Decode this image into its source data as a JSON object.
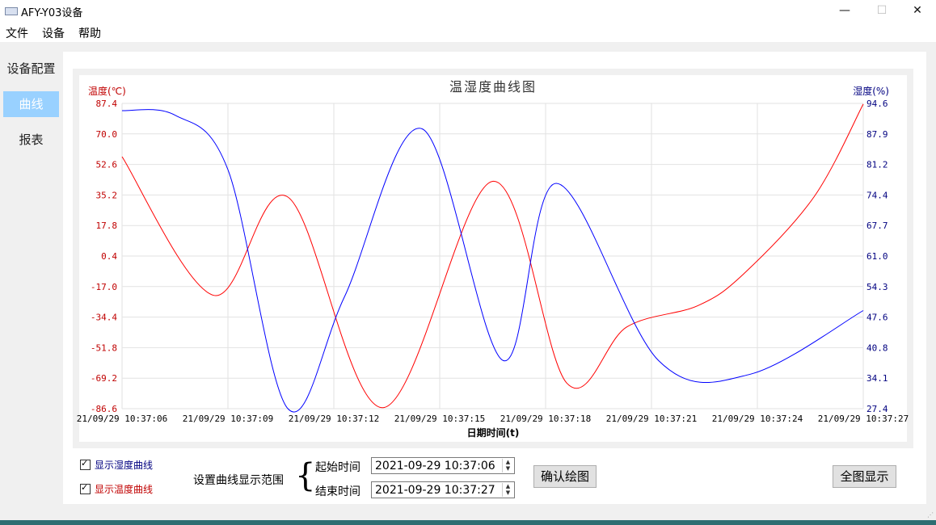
{
  "window": {
    "title": "AFY-Y03设备",
    "controls": {
      "minimize": "—",
      "maximize": "☐",
      "close": "✕"
    }
  },
  "menu": {
    "items": [
      "文件",
      "设备",
      "帮助"
    ]
  },
  "sidebar": {
    "items": [
      {
        "label": "设备配置",
        "active": false
      },
      {
        "label": "曲线",
        "active": true
      },
      {
        "label": "报表",
        "active": false
      }
    ]
  },
  "controls": {
    "show_humidity_label": "显示湿度曲线",
    "show_humidity_checked": true,
    "show_temperature_label": "显示温度曲线",
    "show_temperature_checked": true,
    "range_label": "设置曲线显示范围",
    "brace": "{",
    "start_label": "起始时间",
    "start_value": "2021-09-29 10:37:06",
    "end_label": "结束时间",
    "end_value": "2021-09-29 10:37:27",
    "confirm_button": "确认绘图",
    "fullview_button": "全图显示"
  },
  "colors": {
    "temperature": "#ff0000",
    "humidity": "#0000ff",
    "grid": "#e2e2e2",
    "accent_sidebar": "#99d1ff",
    "temperature_label": "#c00000",
    "humidity_label": "#000080"
  },
  "chart_data": {
    "type": "line",
    "title": "温湿度曲线图",
    "xlabel": "日期时间(t)",
    "ylabel_left": "温度(℃)",
    "ylabel_right": "湿度(%)",
    "x_ticks": [
      "21/09/29 10:37:06",
      "21/09/29 10:37:09",
      "21/09/29 10:37:12",
      "21/09/29 10:37:15",
      "21/09/29 10:37:18",
      "21/09/29 10:37:21",
      "21/09/29 10:37:24",
      "21/09/29 10:37:27"
    ],
    "y_left_ticks": [
      "87.4",
      "70.0",
      "52.6",
      "35.2",
      "17.8",
      "0.4",
      "-17.0",
      "-34.4",
      "-51.8",
      "-69.2",
      "-86.6"
    ],
    "y_right_ticks": [
      "94.6",
      "87.9",
      "81.2",
      "74.4",
      "67.7",
      "61.0",
      "54.3",
      "47.6",
      "40.8",
      "34.1",
      "27.4"
    ],
    "y_left_range": [
      -86.6,
      87.4
    ],
    "y_right_range": [
      27.4,
      94.6
    ],
    "x_range_seconds": [
      0,
      21
    ],
    "grid": true,
    "series": [
      {
        "name": "温度",
        "axis": "left",
        "x": [
          0,
          2.6,
          4.7,
          7.4,
          10.5,
          12.6,
          14.3,
          16.3,
          17.6,
          19.6,
          21
        ],
        "values": [
          57,
          -22,
          34,
          -86,
          43,
          -72,
          -40,
          -28,
          -10,
          34,
          87
        ]
      },
      {
        "name": "湿度",
        "axis": "right",
        "x": [
          0,
          1.5,
          3,
          4.7,
          6.3,
          8.5,
          10.8,
          12.3,
          15.2,
          17.8,
          21
        ],
        "values": [
          93,
          92,
          80,
          27.4,
          52,
          89,
          38,
          77,
          38,
          35,
          49
        ]
      }
    ]
  }
}
